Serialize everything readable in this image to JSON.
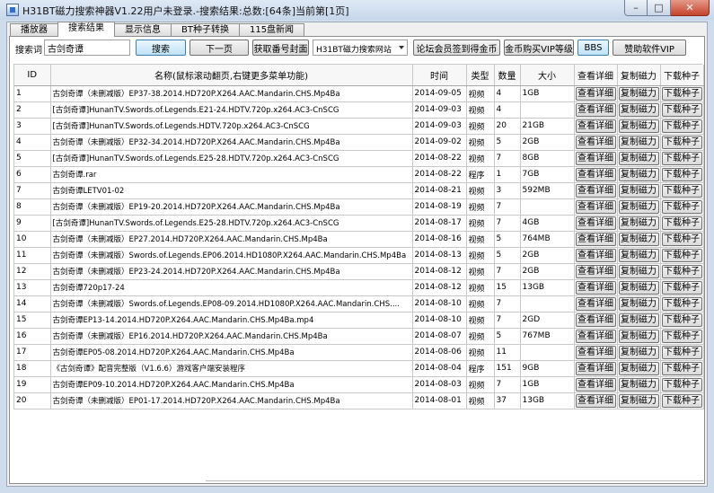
{
  "window": {
    "title": "H31BT磁力搜索神器V1.22用户未登录.-搜索结果:总数:[64条]当前第[1页]",
    "minimize": "–",
    "maximize": "□",
    "close": "✕"
  },
  "tabs": [
    "播放器",
    "搜索结果",
    "显示信息",
    "BT种子转换",
    "115盘新闻"
  ],
  "toolbar": {
    "search_label": "搜索词",
    "search_value": "古剑奇谭",
    "search_button": "搜索",
    "next_button": "下一页",
    "cover_button": "获取番号封面",
    "site_select": "H31BT磁力搜索网站",
    "signin_button": "论坛会员签到得金币",
    "vip_button": "金币购买VIP等级",
    "bbs_button": "BBS",
    "sponsor_button": "赞助软件VIP"
  },
  "table": {
    "columns": [
      "ID",
      "名称(鼠标滚动翻页,右键更多菜单功能)",
      "时间",
      "类型",
      "数量",
      "大小",
      "查看详细",
      "复制磁力",
      "下载种子"
    ],
    "action_labels": [
      "查看详细",
      "复制磁力",
      "下载种子"
    ],
    "rows": [
      [
        "1",
        "古剑奇谭（未删减版）EP37-38.2014.HD720P.X264.AAC.Mandarin.CHS.Mp4Ba",
        "2014-09-05",
        "视频",
        "4",
        "1GB"
      ],
      [
        "2",
        "[古剑奇谭]HunanTV.Swords.of.Legends.E21-24.HDTV.720p.x264.AC3-CnSCG",
        "2014-09-03",
        "视频",
        "4",
        ""
      ],
      [
        "3",
        "[古剑奇谭]HunanTV.Swords.of.Legends.HDTV.720p.x264.AC3-CnSCG",
        "2014-09-03",
        "视频",
        "20",
        "21GB"
      ],
      [
        "4",
        "古剑奇谭（未删减版）EP32-34.2014.HD720P.X264.AAC.Mandarin.CHS.Mp4Ba",
        "2014-09-02",
        "视频",
        "5",
        "2GB"
      ],
      [
        "5",
        "[古剑奇谭]HunanTV.Swords.of.Legends.E25-28.HDTV.720p.x264.AC3-CnSCG",
        "2014-08-22",
        "视频",
        "7",
        "8GB"
      ],
      [
        "6",
        "古剑奇谭.rar",
        "2014-08-22",
        "程序",
        "1",
        "7GB"
      ],
      [
        "7",
        "古剑奇谭LETV01-02",
        "2014-08-21",
        "视频",
        "3",
        "592MB"
      ],
      [
        "8",
        "古剑奇谭（未删减版）EP19-20.2014.HD720P.X264.AAC.Mandarin.CHS.Mp4Ba",
        "2014-08-19",
        "视频",
        "7",
        ""
      ],
      [
        "9",
        "[古剑奇谭]HunanTV.Swords.of.Legends.E25-28.HDTV.720p.x264.AC3-CnSCG",
        "2014-08-17",
        "视频",
        "7",
        "4GB"
      ],
      [
        "10",
        "古剑奇谭（未删减版）EP27.2014.HD720P.X264.AAC.Mandarin.CHS.Mp4Ba",
        "2014-08-16",
        "视频",
        "5",
        "764MB"
      ],
      [
        "11",
        "古剑奇谭（未删减版）Swords.of.Legends.EP06.2014.HD1080P.X264.AAC.Mandarin.CHS.Mp4Ba",
        "2014-08-13",
        "视频",
        "5",
        "2GB"
      ],
      [
        "12",
        "古剑奇谭（未删减版）EP23-24.2014.HD720P.X264.AAC.Mandarin.CHS.Mp4Ba",
        "2014-08-12",
        "视频",
        "7",
        "2GB"
      ],
      [
        "13",
        "古剑奇谭720p17-24",
        "2014-08-12",
        "视频",
        "15",
        "13GB"
      ],
      [
        "14",
        "古剑奇谭（未删减版）Swords.of.Legends.EP08-09.2014.HD1080P.X264.AAC.Mandarin.CHS....",
        "2014-08-10",
        "视频",
        "7",
        ""
      ],
      [
        "15",
        "古剑奇谭EP13-14.2014.HD720P.X264.AAC.Mandarin.CHS.Mp4Ba.mp4",
        "2014-08-10",
        "视频",
        "7",
        "2GD"
      ],
      [
        "16",
        "古剑奇谭（未删减版）EP16.2014.HD720P.X264.AAC.Mandarin.CHS.Mp4Ba",
        "2014-08-07",
        "视频",
        "5",
        "767MB"
      ],
      [
        "17",
        "古剑奇谭EP05-08.2014.HD720P.X264.AAC.Mandarin.CHS.Mp4Ba",
        "2014-08-06",
        "视频",
        "11",
        ""
      ],
      [
        "18",
        "《古剑奇谭》配音完整版（V1.6.6）游戏客户端安装程序",
        "2014-08-04",
        "程序",
        "151",
        "9GB"
      ],
      [
        "19",
        "古剑奇谭EP09-10.2014.HD720P.X264.AAC.Mandarin.CHS.Mp4Ba",
        "2014-08-03",
        "视频",
        "7",
        "1GB"
      ],
      [
        "20",
        "古剑奇谭（未删减版）EP01-17.2014.HD720P.X264.AAC.Mandarin.CHS.Mp4Ba",
        "2014-08-01",
        "视频",
        "37",
        "13GB"
      ]
    ]
  }
}
